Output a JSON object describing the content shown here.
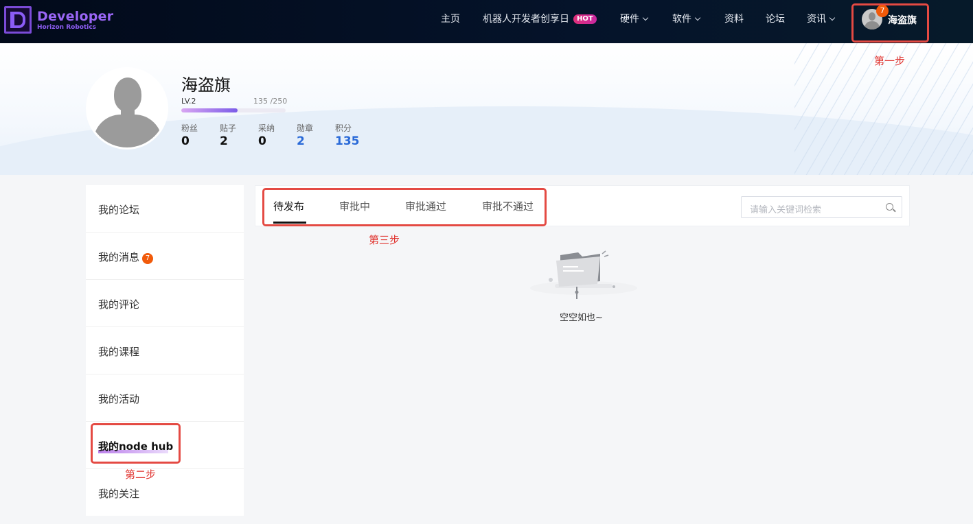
{
  "brand": {
    "title": "Developer",
    "subtitle": "Horizon Robotics"
  },
  "nav": {
    "home": "主页",
    "creator_day": "机器人开发者创享日",
    "hot_badge": "HOT",
    "hardware": "硬件",
    "software": "软件",
    "resources": "资料",
    "forum": "论坛",
    "news": "资讯"
  },
  "user": {
    "name": "海盗旗",
    "notification_count": "7"
  },
  "annotations": {
    "step1": "第一步",
    "step2": "第二步",
    "step3": "第三步"
  },
  "profile": {
    "name": "海盗旗",
    "level": "LV.2",
    "progress_text": "135 /250",
    "progress_fraction": 0.54,
    "stats": [
      {
        "label": "粉丝",
        "value": "0"
      },
      {
        "label": "贴子",
        "value": "2"
      },
      {
        "label": "采纳",
        "value": "0"
      },
      {
        "label": "勋章",
        "value": "2"
      },
      {
        "label": "积分",
        "value": "135"
      }
    ]
  },
  "sidebar": {
    "items": [
      {
        "label": "我的论坛"
      },
      {
        "label": "我的消息",
        "badge": "7"
      },
      {
        "label": "我的评论"
      },
      {
        "label": "我的课程"
      },
      {
        "label": "我的活动"
      },
      {
        "label": "我的node hub"
      },
      {
        "label": "我的关注"
      }
    ]
  },
  "tabs": [
    {
      "label": "待发布",
      "active": true
    },
    {
      "label": "审批中"
    },
    {
      "label": "审批通过"
    },
    {
      "label": "审批不通过"
    }
  ],
  "search": {
    "placeholder": "请输入关键词检索"
  },
  "empty": {
    "text": "空空如也~"
  },
  "colors": {
    "accent_red": "#e44a43",
    "badge": "#f15a0a",
    "brand_purple": "#9a66f5",
    "link_blue": "#2a6ad8"
  }
}
